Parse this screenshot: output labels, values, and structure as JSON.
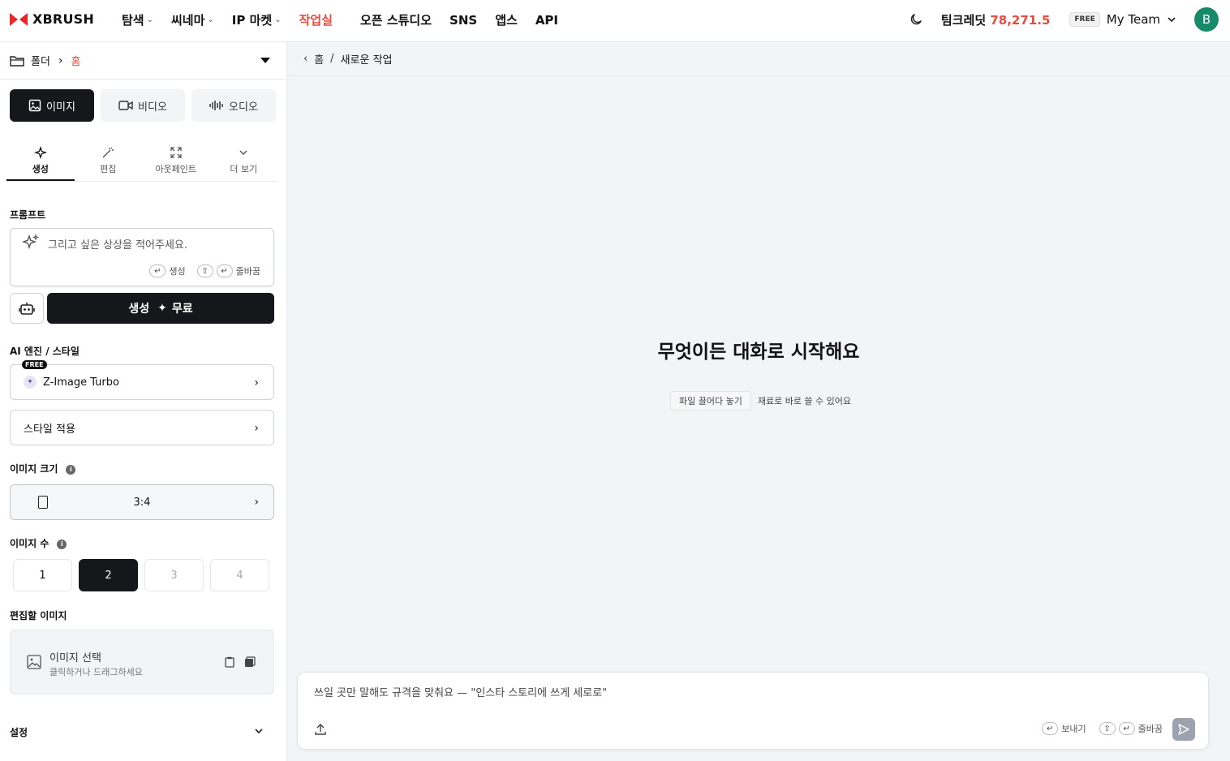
{
  "header": {
    "brand": "XBRUSH",
    "nav": [
      {
        "label": "탐색",
        "has_menu": true,
        "active": false
      },
      {
        "label": "씨네마",
        "has_menu": true,
        "active": false
      },
      {
        "label": "IP 마켓",
        "has_menu": true,
        "active": false
      },
      {
        "label": "작업실",
        "has_menu": false,
        "active": true
      },
      {
        "label": "오픈 스튜디오",
        "has_menu": false,
        "active": false
      },
      {
        "label": "SNS",
        "has_menu": false,
        "active": false
      },
      {
        "label": "앱스",
        "has_menu": false,
        "active": false
      },
      {
        "label": "API",
        "has_menu": false,
        "active": false
      }
    ],
    "credit_label": "팀크레딧",
    "credit_value": "78,271.5",
    "plan_badge": "FREE",
    "team_name": "My Team",
    "avatar_initial": "B",
    "accent_color": "#e84a3f"
  },
  "sidebar": {
    "folder_label": "폴더",
    "folder_current": "홈",
    "mode_tabs": [
      {
        "label": "이미지",
        "icon": "image-icon",
        "active": true
      },
      {
        "label": "비디오",
        "icon": "video-icon",
        "active": false
      },
      {
        "label": "오디오",
        "icon": "audio-wave-icon",
        "active": false
      }
    ],
    "sub_tabs": [
      {
        "label": "생성",
        "icon": "sparkle-icon",
        "active": true
      },
      {
        "label": "편집",
        "icon": "magic-wand-icon",
        "active": false
      },
      {
        "label": "아웃페인트",
        "icon": "expand-icon",
        "active": false
      },
      {
        "label": "더 보기",
        "icon": "chevron-down-icon",
        "active": false
      }
    ],
    "prompt_label": "프롬프트",
    "prompt_placeholder": "그리고 싶은 상상을 적어주세요.",
    "prompt_hint_generate": "생성",
    "prompt_hint_newline": "줄바꿈",
    "generate_label": "생성",
    "generate_cost": "무료",
    "engine_label": "AI 엔진 / 스타일",
    "engine_badge": "FREE",
    "engine_name": "Z-Image Turbo",
    "style_label": "스타일 적용",
    "size_label": "이미지 크기",
    "size_value": "3:4",
    "count_label": "이미지 수",
    "counts": [
      {
        "label": "1",
        "state": "normal"
      },
      {
        "label": "2",
        "state": "selected"
      },
      {
        "label": "3",
        "state": "disabled"
      },
      {
        "label": "4",
        "state": "disabled"
      }
    ],
    "edit_image_label": "편집할 이미지",
    "image_select_title": "이미지 선택",
    "image_select_sub": "클릭하거나 드래그하세요",
    "settings_label": "설정"
  },
  "main": {
    "breadcrumb_home": "홈",
    "breadcrumb_sep": "/",
    "breadcrumb_current": "새로운 작업",
    "hero_title": "무엇이든 대화로 시작해요",
    "drop_chip": "파일 끌어다 놓기",
    "drop_text": "재료로 바로 쓸 수 있어요",
    "composer_placeholder": "쓰일 곳만 말해도 규격을 맞춰요 — \"인스타 스토리에 쓰게 세로로\"",
    "composer_hint_send": "보내기",
    "composer_hint_newline": "줄바꿈"
  }
}
